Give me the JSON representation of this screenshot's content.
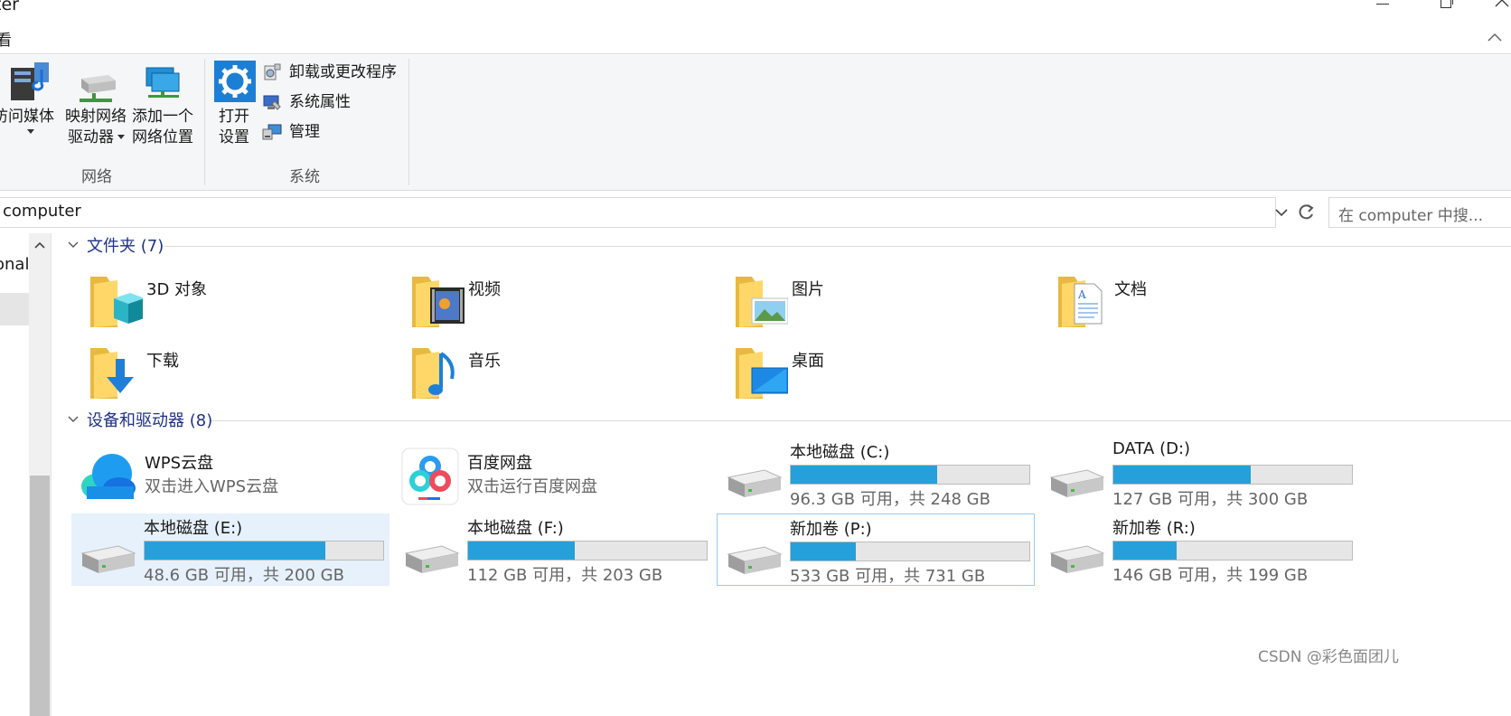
{
  "window": {
    "title": "ter",
    "minimize_label": "minimize",
    "maximize_label": "restore",
    "close_label": "close"
  },
  "menu": {
    "view_tab": "看"
  },
  "ribbon": {
    "network": {
      "group_label": "网络",
      "access_media": "访问媒体",
      "map_drive_line1": "映射网络",
      "map_drive_line2": "驱动器",
      "add_location_line1": "添加一个",
      "add_location_line2": "网络位置"
    },
    "system": {
      "group_label": "系统",
      "open_settings_line1": "打开",
      "open_settings_line2": "设置",
      "uninstall": "卸载或更改程序",
      "properties": "系统属性",
      "manage": "管理"
    }
  },
  "address": {
    "path": "computer",
    "search_placeholder": "在 computer 中搜..."
  },
  "nav": {
    "partial_label": "onal"
  },
  "folders_section": {
    "title": "文件夹 (7)",
    "items": [
      {
        "label": "3D 对象",
        "icon": "3d-objects-folder-icon"
      },
      {
        "label": "视频",
        "icon": "videos-folder-icon"
      },
      {
        "label": "图片",
        "icon": "pictures-folder-icon"
      },
      {
        "label": "文档",
        "icon": "documents-folder-icon"
      },
      {
        "label": "下载",
        "icon": "downloads-folder-icon"
      },
      {
        "label": "音乐",
        "icon": "music-folder-icon"
      },
      {
        "label": "桌面",
        "icon": "desktop-folder-icon"
      }
    ]
  },
  "devices_section": {
    "title": "设备和驱动器 (8)",
    "cloud": [
      {
        "name": "WPS云盘",
        "desc": "双击进入WPS云盘",
        "icon": "wps-cloud-icon"
      },
      {
        "name": "百度网盘",
        "desc": "双击运行百度网盘",
        "icon": "baidu-netdisk-icon"
      }
    ],
    "drives": [
      {
        "name": "本地磁盘 (C:)",
        "info": "96.3 GB 可用，共 248 GB",
        "used_fraction": 0.612
      },
      {
        "name": "DATA (D:)",
        "info": "127 GB 可用，共 300 GB",
        "used_fraction": 0.577
      },
      {
        "name": "本地磁盘 (E:)",
        "info": "48.6 GB 可用，共 200 GB",
        "used_fraction": 0.757
      },
      {
        "name": "本地磁盘 (F:)",
        "info": "112 GB 可用，共 203 GB",
        "used_fraction": 0.448
      },
      {
        "name": "新加卷 (P:)",
        "info": "533 GB 可用，共 731 GB",
        "used_fraction": 0.271
      },
      {
        "name": "新加卷 (R:)",
        "info": "146 GB 可用，共 199 GB",
        "used_fraction": 0.266
      }
    ]
  },
  "watermark": "CSDN @彩色面团儿",
  "colors": {
    "accent": "#26a0da",
    "section_title": "#1e3287",
    "selection": "#e6f1fb"
  }
}
